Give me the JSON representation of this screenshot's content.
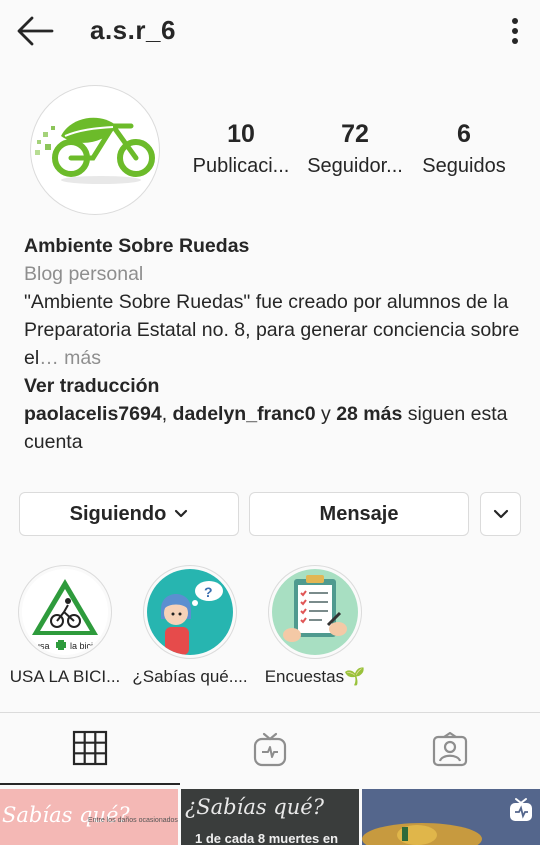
{
  "header": {
    "username": "a.s.r_6",
    "back_icon": "arrow-left-icon",
    "more_icon": "more-vertical-icon"
  },
  "profile": {
    "avatar_icon": "bicycle-leaf-logo",
    "stats": {
      "posts": {
        "count": "10",
        "label": "Publicaci..."
      },
      "followers": {
        "count": "72",
        "label": "Seguidor..."
      },
      "following": {
        "count": "6",
        "label": "Seguidos"
      }
    },
    "name": "Ambiente Sobre Ruedas",
    "category": "Blog personal",
    "bio_text": "\"Ambiente Sobre Ruedas\" fue creado por alumnos de la Preparatoria Estatal no. 8, para generar conciencia sobre el",
    "bio_more": "… más",
    "translate": "Ver traducción",
    "followed_by": {
      "user1": "paolacelis7694",
      "sep": ", ",
      "user2": "dadelyn_franc0",
      "and": " y ",
      "others": "28 más",
      "suffix": " siguen esta cuenta"
    }
  },
  "actions": {
    "following_label": "Siguiendo",
    "message_label": "Mensaje"
  },
  "highlights": [
    {
      "label": "USA LA BICI...",
      "image": "use-bike-sign"
    },
    {
      "label": "¿Sabías qué....",
      "image": "thinking-girl"
    },
    {
      "label": "Encuestas🌱",
      "image": "survey-clipboard"
    }
  ],
  "tabs": [
    {
      "icon": "grid-icon",
      "active": true
    },
    {
      "icon": "igtv-icon",
      "active": false
    },
    {
      "icon": "tagged-icon",
      "active": false
    }
  ],
  "posts": [
    {
      "text": "Sabías qué?",
      "subtext": "Entre los daños ocasionados"
    },
    {
      "text": "¿Sabías qué?",
      "subtext": "1 de cada 8 muertes en"
    },
    {
      "text": "",
      "badge_icon": "igtv-badge-icon"
    }
  ],
  "colors": {
    "text": "#262626",
    "secondary": "#8e8e8e",
    "border": "#dbdbdb",
    "logo_green": "#6cbb2a"
  }
}
